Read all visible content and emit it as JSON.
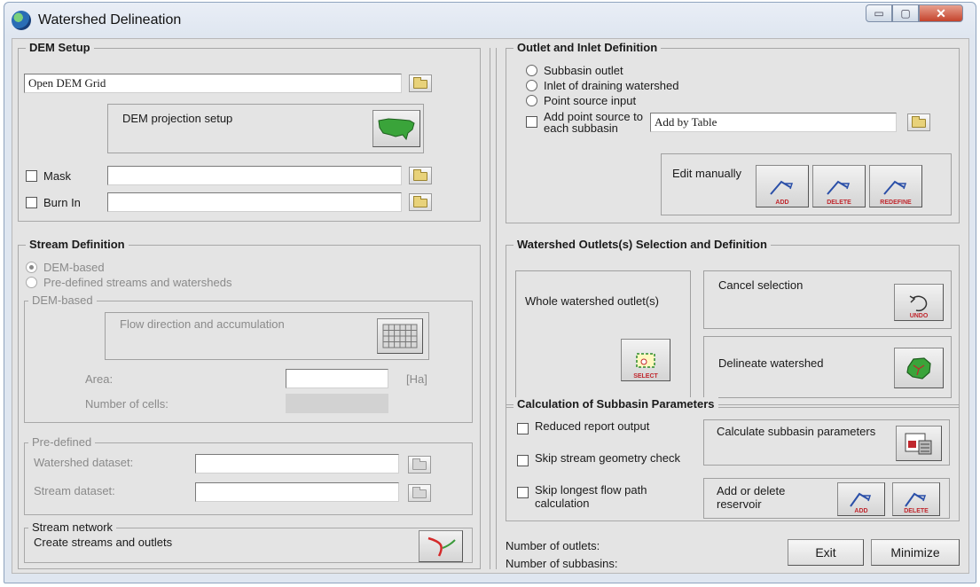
{
  "window": {
    "title": "Watershed Delineation",
    "min_glyph": "▭",
    "max_glyph": "▢",
    "close_glyph": "✕"
  },
  "dem_setup": {
    "legend": "DEM Setup",
    "dem_grid_value": "Open DEM Grid",
    "projection_label": "DEM projection setup",
    "mask_label": "Mask",
    "burn_in_label": "Burn In"
  },
  "stream_definition": {
    "legend": "Stream Definition",
    "option_dem": "DEM-based",
    "option_predefined": "Pre-defined streams and watersheds",
    "dem_group_legend": "DEM-based",
    "flow_label": "Flow direction and accumulation",
    "area_label": "Area:",
    "area_unit": "[Ha]",
    "cells_label": "Number of cells:",
    "predefined_legend": "Pre-defined",
    "watershed_dataset_label": "Watershed dataset:",
    "stream_dataset_label": "Stream dataset:",
    "network_legend": "Stream network",
    "network_label": "Create streams and outlets"
  },
  "outlet_inlet": {
    "legend": "Outlet and Inlet Definition",
    "option_subbasin": "Subbasin outlet",
    "option_inlet": "Inlet of draining watershed",
    "option_point": "Point source input",
    "add_point_label": "Add point source to each subbasin",
    "add_by_table_value": "Add by Table",
    "edit_label": "Edit manually",
    "btn_add": "ADD",
    "btn_delete": "DELETE",
    "btn_redefine": "REDEFINE"
  },
  "outlets_selection": {
    "legend": "Watershed Outlets(s) Selection and Definition",
    "whole_label": "Whole watershed outlet(s)",
    "select_caption": "SELECT",
    "cancel_label": "Cancel selection",
    "undo_caption": "UNDO",
    "delineate_label": "Delineate watershed"
  },
  "subbasin_params": {
    "legend": "Calculation of Subbasin Parameters",
    "reduced_label": "Reduced report output",
    "skip_stream_label": "Skip stream geometry check",
    "skip_longest_label": "Skip longest flow path calculation",
    "calc_label": "Calculate subbasin parameters",
    "reservoir_label": "Add or delete reservoir",
    "res_add": "ADD",
    "res_delete": "DELETE"
  },
  "footer": {
    "outlets_label": "Number of outlets:",
    "subbasins_label": "Number of subbasins:",
    "exit_label": "Exit",
    "minimize_label": "Minimize"
  },
  "colors": {
    "accent_red": "#c0272d",
    "map_green": "#3aa43a",
    "panel_bg": "#e4e4e4"
  }
}
